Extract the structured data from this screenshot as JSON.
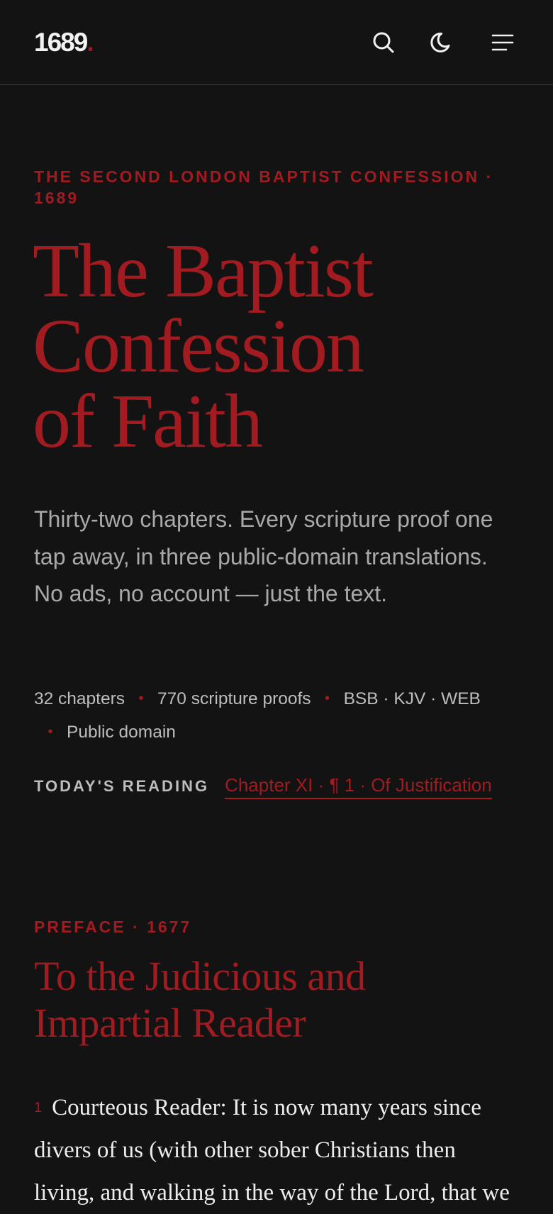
{
  "header": {
    "logo_text": "1689",
    "logo_dot": ".",
    "icons": {
      "search": "search-icon",
      "theme": "moon-icon",
      "menu": "menu-icon"
    }
  },
  "hero": {
    "eyebrow": "The Second London Baptist Confession · 1689",
    "title_lines": [
      "The Baptist",
      "Confession",
      "of Faith"
    ],
    "lede": "Thirty-two chapters. Every scripture proof one tap away, in three public-domain translations. No ads, no account — just the text."
  },
  "stats": {
    "items": [
      "32 chapters",
      "770 scripture proofs",
      "BSB · KJV · WEB",
      "Public domain"
    ],
    "separator": "•"
  },
  "today": {
    "label": "Today's Reading",
    "link": "Chapter XI · ¶ 1 · Of Justification"
  },
  "preface": {
    "eyebrow": "Preface · 1677",
    "title_lines": [
      "To the Judicious and",
      "Impartial Reader"
    ],
    "paragraph_number": "1",
    "paragraph_text": "Courteous Reader: It is now many years since divers of us (with other sober Christians then living, and walking in the way of the Lord, that we"
  },
  "colors": {
    "background": "#131313",
    "accent": "#a11b20",
    "body_text": "#ededed",
    "muted_text": "#a9a9a9"
  }
}
